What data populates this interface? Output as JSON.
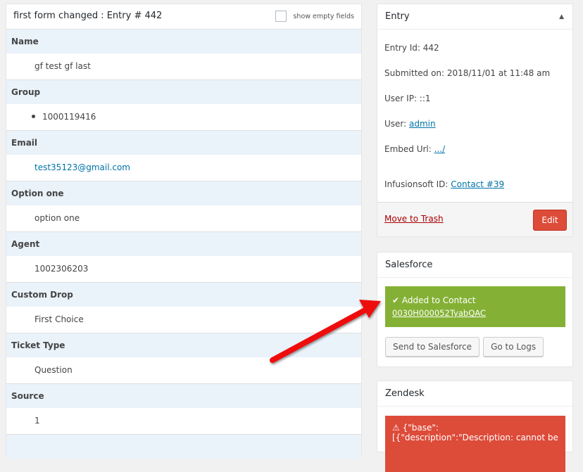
{
  "left": {
    "title": "first form changed : Entry # 442",
    "show_empty_label": "show empty fields",
    "show_empty_checked": false,
    "fields": [
      {
        "label": "Name",
        "value": "gf test gf last",
        "type": "text"
      },
      {
        "label": "Group",
        "value": "1000119416",
        "type": "list"
      },
      {
        "label": "Email",
        "value": "test35123@gmail.com",
        "type": "link"
      },
      {
        "label": "Option one",
        "value": "option one",
        "type": "text"
      },
      {
        "label": "Agent",
        "value": "1002306203",
        "type": "text"
      },
      {
        "label": "Custom Drop",
        "value": "First Choice",
        "type": "text"
      },
      {
        "label": "Ticket Type",
        "value": "Question",
        "type": "text"
      },
      {
        "label": "Source",
        "value": "1",
        "type": "text"
      }
    ]
  },
  "entry_box": {
    "title": "Entry",
    "toggle_icon": "triangle-up",
    "entry_id_label": "Entry Id: 442",
    "submitted_label": "Submitted on: 2018/11/01 at 11:48 am",
    "user_ip_label": "User IP: ::1",
    "user_label": "User: ",
    "user_link": "admin",
    "embed_label": "Embed Url: ",
    "embed_link": ".../",
    "infusionsoft_label": "Infusionsoft ID: ",
    "infusionsoft_link": "Contact #39",
    "trash_label": "Move to Trash",
    "edit_label": "Edit"
  },
  "salesforce_box": {
    "title": "Salesforce",
    "status_icon": "checkmark",
    "status_text": "Added to Contact",
    "contact_link": "0030H000052TyabQAC",
    "send_button": "Send to Salesforce",
    "logs_button": "Go to Logs",
    "success_color": "#84b135"
  },
  "zendesk_box": {
    "title": "Zendesk",
    "error_icon": "warning",
    "error_text": "{\"base\":[{\"description\":\"Description: cannot be",
    "error_color": "#dd4b39"
  },
  "annotation": {
    "arrow_color": "#ee1111"
  }
}
